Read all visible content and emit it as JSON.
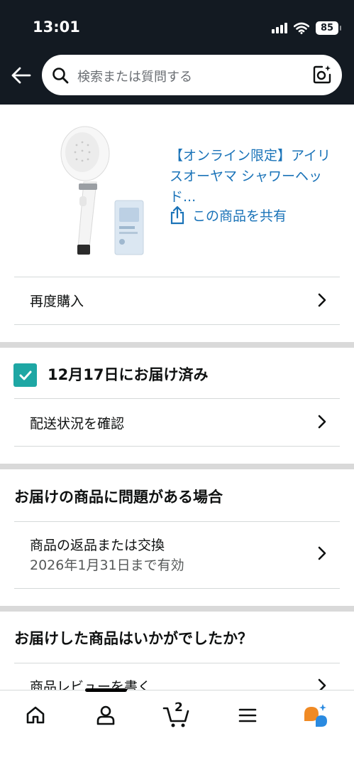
{
  "status_bar": {
    "time": "13:01",
    "battery": "85"
  },
  "search": {
    "placeholder": "検索または質問する"
  },
  "product": {
    "title": "【オンライン限定】アイリスオーヤマ シャワーヘッド...",
    "share_label": "この商品を共有",
    "rebuy_label": "再度購入"
  },
  "delivery": {
    "status": "12月17日にお届け済み",
    "track_label": "配送状況を確認"
  },
  "problem": {
    "heading": "お届けの商品に問題がある場合",
    "return_label": "商品の返品または交換",
    "return_deadline": "2026年1月31日まで有効"
  },
  "review": {
    "heading": "お届けした商品はいかがでしたか？",
    "write_review_label": "商品レビューを書く"
  },
  "bottom_nav": {
    "cart_count": "2",
    "items": [
      "home-icon",
      "account-icon",
      "cart-icon",
      "menu-icon",
      "rufus-ai-icon"
    ]
  },
  "colors": {
    "header_bg": "#131a22",
    "link": "#1a73b8",
    "check_bg": "#1ea7a4",
    "ai_orange": "#f08a24",
    "ai_blue": "#2a8ae0"
  }
}
